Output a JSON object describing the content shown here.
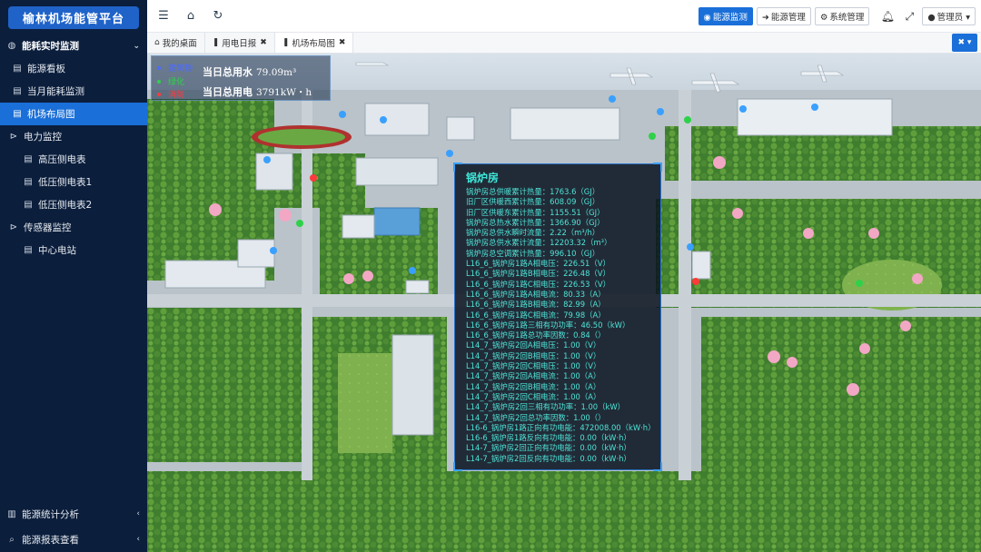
{
  "app": {
    "title": "榆林机场能管平台"
  },
  "sidebar": {
    "top": {
      "label": "能耗实时监测"
    },
    "items": [
      {
        "label": "能源看板",
        "level": 1
      },
      {
        "label": "当月能耗监测",
        "level": 1
      },
      {
        "label": "机场布局图",
        "level": 1,
        "active": true
      },
      {
        "label": "电力监控",
        "level": 0,
        "group": true
      },
      {
        "label": "高压侧电表",
        "level": 2
      },
      {
        "label": "低压侧电表1",
        "level": 2
      },
      {
        "label": "低压侧电表2",
        "level": 2
      },
      {
        "label": "传感器监控",
        "level": 0,
        "group": true
      },
      {
        "label": "中心电站",
        "level": 2
      }
    ],
    "bottom": [
      {
        "label": "能源统计分析"
      },
      {
        "label": "能源报表查看"
      }
    ]
  },
  "header": {
    "buttons": [
      {
        "label": "能源监测",
        "active": true
      },
      {
        "label": "能源管理",
        "active": false
      },
      {
        "label": "系统管理",
        "active": false
      }
    ],
    "user": "管理员"
  },
  "tabs": [
    {
      "label": "我的桌面",
      "closable": false,
      "active": false
    },
    {
      "label": "用电日报",
      "closable": true,
      "active": false
    },
    {
      "label": "机场布局图",
      "closable": true,
      "active": true
    }
  ],
  "legend": {
    "items": [
      {
        "label": "建筑物",
        "color": "#4b6bff"
      },
      {
        "label": "绿化",
        "color": "#2fd14a"
      },
      {
        "label": "消防",
        "color": "#ff3a3a"
      }
    ],
    "water": {
      "label": "当日总用水",
      "value": "79.09m³"
    },
    "power": {
      "label": "当日总用电",
      "value": "3791kW・h"
    }
  },
  "popup": {
    "title": "锅炉房",
    "lines": [
      "锅炉房总供暖累计热量：1763.6（GJ）",
      "旧厂区供暖西累计热量：608.09（GJ）",
      "旧厂区供暖东累计热量：1155.51（GJ）",
      "锅炉房总热水累计热量：1366.90（GJ）",
      "锅炉房总供水瞬时流量：2.22（m³/h）",
      "锅炉房总供水累计流量：12203.32（m³）",
      "锅炉房总空调累计热量：996.10（GJ）",
      "L16_6_锅炉房1路A相电压：226.51（V）",
      "L16_6_锅炉房1路B相电压：226.48（V）",
      "L16_6_锅炉房1路C相电压：226.53（V）",
      "L16_6_锅炉房1路A相电流：80.33（A）",
      "L16_6_锅炉房1路B相电流：82.99（A）",
      "L16_6_锅炉房1路C相电流：79.98（A）",
      "L16_6_锅炉房1路三相有功功率：46.50（kW）",
      "L16_6_锅炉房1路总功率因数：0.84（）",
      "L14_7_锅炉房2回A相电压：1.00（V）",
      "L14_7_锅炉房2回B相电压：1.00（V）",
      "L14_7_锅炉房2回C相电压：1.00（V）",
      "L14_7_锅炉房2回A相电流：1.00（A）",
      "L14_7_锅炉房2回B相电流：1.00（A）",
      "L14_7_锅炉房2回C相电流：1.00（A）",
      "L14_7_锅炉房2回三相有功功率：1.00（kW）",
      "L14_7_锅炉房2回总功率因数：1.00（）",
      "L16-6_锅炉房1路正向有功电能：472008.00（kW·h）",
      "L16-6_锅炉房1路反向有功电能：0.00（kW·h）",
      "L14-7_锅炉房2回正向有功电能：0.00（kW·h）",
      "L14-7_锅炉房2回反向有功电能：0.00（kW·h）"
    ]
  }
}
